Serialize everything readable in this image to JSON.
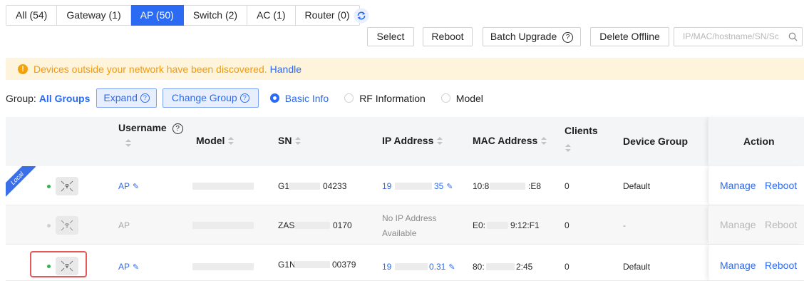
{
  "tabs": [
    {
      "label": "All (54)",
      "active": false
    },
    {
      "label": "Gateway (1)",
      "active": false
    },
    {
      "label": "AP (50)",
      "active": true
    },
    {
      "label": "Switch (2)",
      "active": false
    },
    {
      "label": "AC (1)",
      "active": false
    },
    {
      "label": "Router (0)",
      "active": false
    }
  ],
  "toolbar": {
    "select_label": "Select",
    "reboot_label": "Reboot",
    "batch_upgrade_label": "Batch Upgrade",
    "delete_offline_label": "Delete Offline",
    "search_placeholder": "IP/MAC/hostname/SN/Sc"
  },
  "alert": {
    "message": "Devices outside your network have been discovered.",
    "link": "Handle"
  },
  "group": {
    "label": "Group:",
    "value": "All Groups",
    "expand_label": "Expand",
    "change_group_label": "Change Group",
    "views": [
      "Basic Info",
      "RF Information",
      "Model"
    ],
    "active_view": "Basic Info"
  },
  "table": {
    "headers": {
      "username": "Username",
      "model": "Model",
      "sn": "SN",
      "ip": "IP Address",
      "mac": "MAC Address",
      "clients": "Clients",
      "device_group": "Device Group",
      "action": "Action"
    },
    "rows": [
      {
        "local_badge": "Local",
        "status": "online",
        "username": "AP",
        "sn_prefix": "G1",
        "sn_suffix": "04233",
        "ip_prefix": "19",
        "ip_suffix": "35",
        "mac_prefix": "10:8",
        "mac_suffix": ":E8",
        "clients": "0",
        "device_group": "Default",
        "manage": "Manage",
        "reboot": "Reboot"
      },
      {
        "status": "offline",
        "username": "AP",
        "sn_prefix": "ZAS",
        "sn_suffix": "0170",
        "ip_line1": "No IP Address",
        "ip_line2": "Available",
        "mac_prefix": "E0:",
        "mac_suffix": "9:12:F1",
        "clients": "0",
        "device_group": "-",
        "manage": "Manage",
        "reboot": "Reboot"
      },
      {
        "status": "online",
        "username": "AP",
        "sn_prefix": "G1N",
        "sn_suffix": "00379",
        "ip_prefix": "19",
        "ip_suffix": "0.31",
        "mac_prefix": "80:",
        "mac_suffix": "2:45",
        "clients": "0",
        "device_group": "Default",
        "manage": "Manage",
        "reboot": "Reboot"
      }
    ]
  },
  "colors": {
    "accent": "#2b6af3",
    "warning": "#f39a0c",
    "online": "#37b24d",
    "highlight_box": "#e45858"
  }
}
